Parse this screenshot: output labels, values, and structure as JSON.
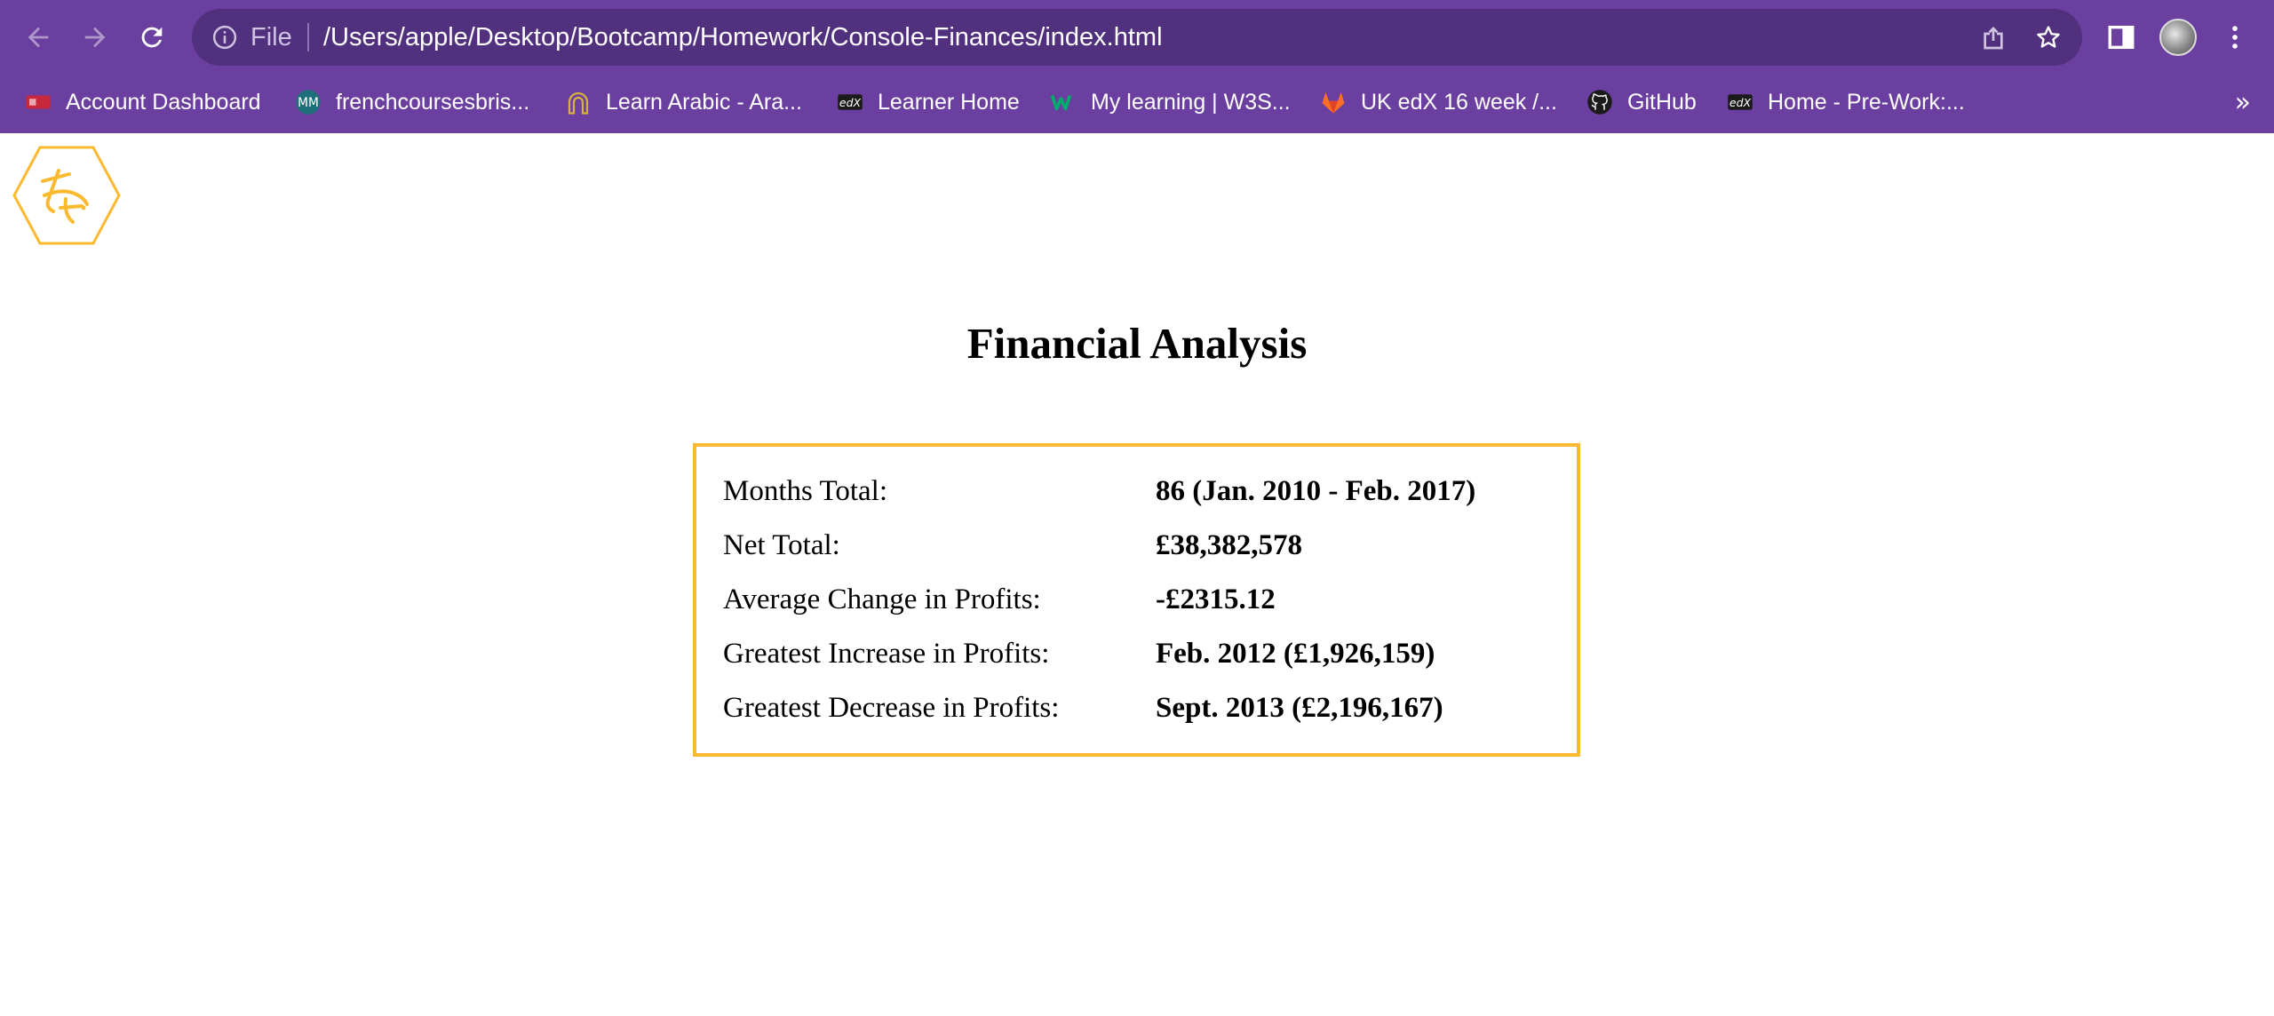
{
  "browser": {
    "scheme_label": "File",
    "url": "/Users/apple/Desktop/Bootcamp/Homework/Console-Finances/index.html",
    "bookmarks": [
      {
        "label": "Account Dashboard",
        "icon": "dashboard-favicon"
      },
      {
        "label": "frenchcoursesbris...",
        "icon": "mm-favicon"
      },
      {
        "label": "Learn Arabic - Ara...",
        "icon": "arch-favicon"
      },
      {
        "label": "Learner Home",
        "icon": "edx-favicon"
      },
      {
        "label": "My learning | W3S...",
        "icon": "w3schools-favicon"
      },
      {
        "label": "UK edX 16 week /...",
        "icon": "gitlab-favicon"
      },
      {
        "label": "GitHub",
        "icon": "github-favicon"
      },
      {
        "label": "Home - Pre-Work:...",
        "icon": "edx-favicon"
      }
    ],
    "overflow_label": "»"
  },
  "page": {
    "title": "Financial Analysis",
    "summary": [
      {
        "label": "Months Total:",
        "value": "86 (Jan. 2010 - Feb. 2017)"
      },
      {
        "label": "Net Total:",
        "value": "£38,382,578"
      },
      {
        "label": "Average Change in Profits:",
        "value": "-£2315.12"
      },
      {
        "label": "Greatest Increase in Profits:",
        "value": "Feb. 2012 (£1,926,159)"
      },
      {
        "label": "Greatest Decrease in Profits:",
        "value": "Sept. 2013 (£2,196,167)"
      }
    ]
  },
  "colors": {
    "chrome": "#6b3fa0",
    "omnibox": "#51307d",
    "accent_border": "#fbb930"
  }
}
